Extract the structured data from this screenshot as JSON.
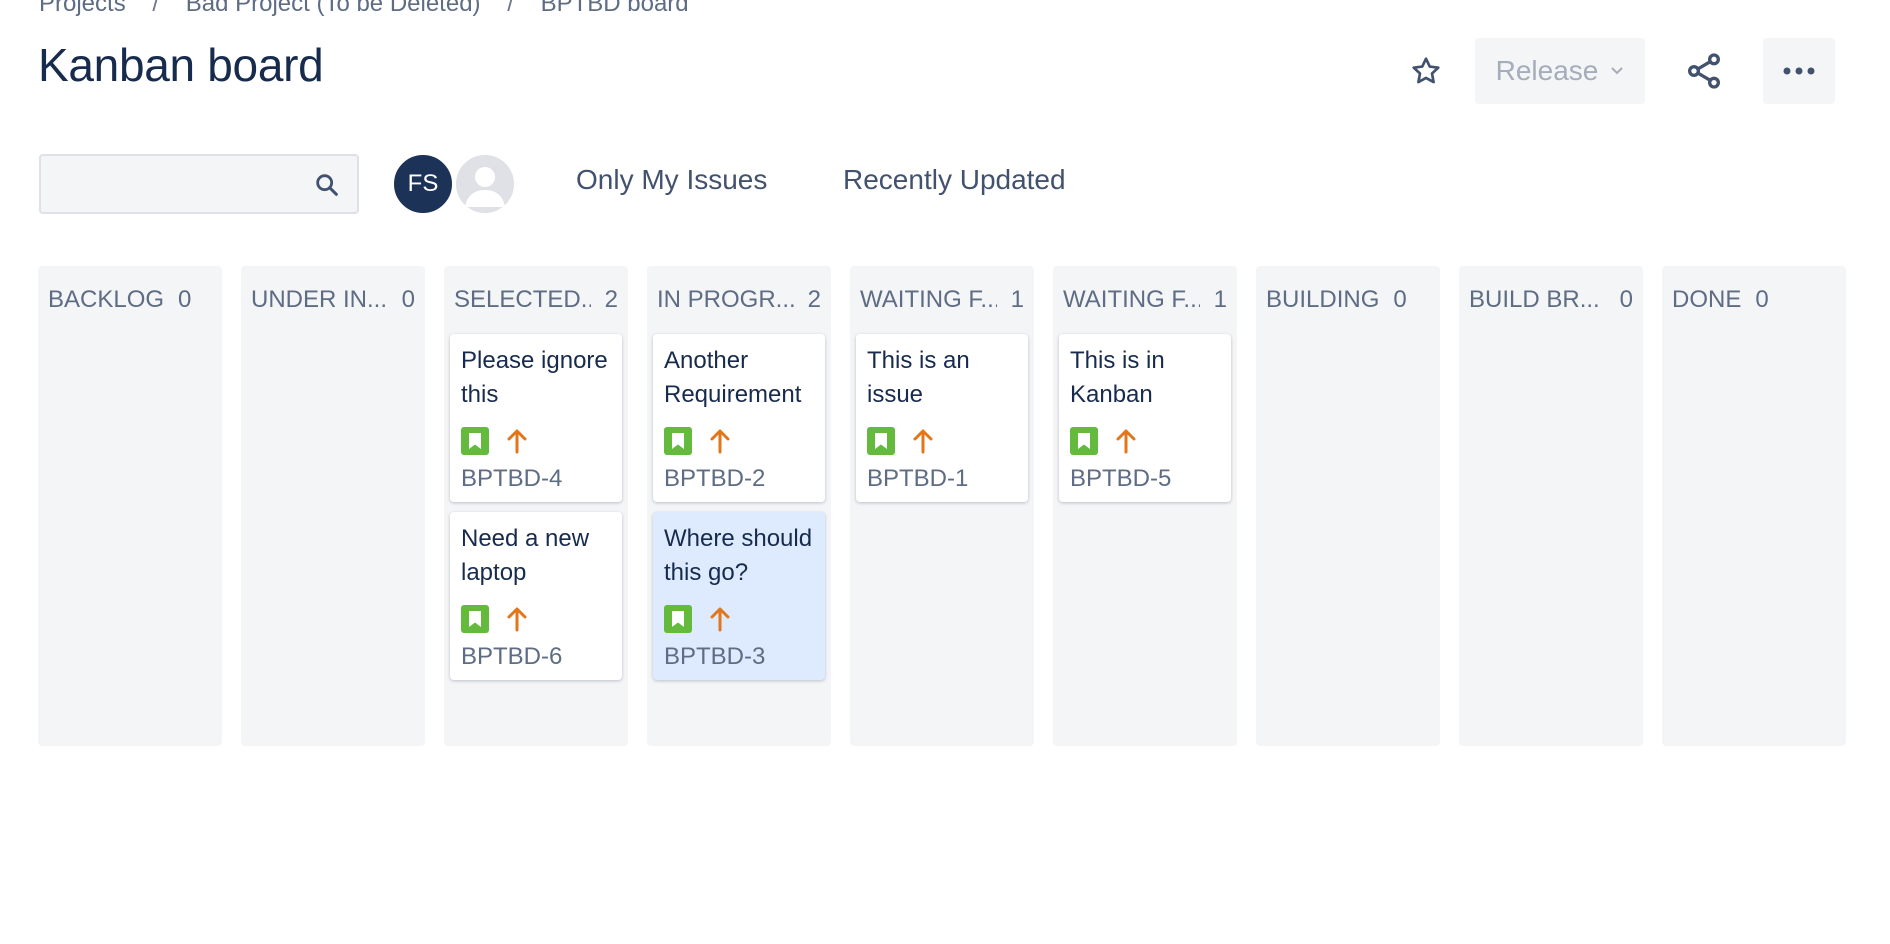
{
  "breadcrumbs": [
    {
      "label": "Projects"
    },
    {
      "label": "Bad Project (To be Deleted)"
    },
    {
      "label": "BPTBD board"
    }
  ],
  "breadcrumb_separator": "/",
  "title": "Kanban board",
  "actions": {
    "release_label": "Release",
    "star_icon": "star-icon",
    "share_icon": "share-icon",
    "more_icon": "more-icon"
  },
  "search": {
    "value": "",
    "placeholder": ""
  },
  "avatars": [
    {
      "initials": "FS",
      "color": "#1c3257"
    },
    {
      "initials": "",
      "color": "#dfe1e6"
    }
  ],
  "quick_filters": {
    "only_mine": "Only My Issues",
    "recently_updated": "Recently Updated"
  },
  "colors": {
    "story": "#63ba3c",
    "priority_high": "#e2761b",
    "selected_card": "#deebff",
    "column_bg": "#f4f5f7"
  },
  "columns": [
    {
      "name": "BACKLOG",
      "count": "0",
      "cards": []
    },
    {
      "name": "UNDER IN...",
      "count": "0",
      "cards": []
    },
    {
      "name": "SELECTED...",
      "count": "2",
      "cards": [
        {
          "summary": "Please ignore this",
          "key": "BPTBD-4",
          "type": "story",
          "priority": "high",
          "selected": false
        },
        {
          "summary": "Need a new laptop",
          "key": "BPTBD-6",
          "type": "story",
          "priority": "high",
          "selected": false
        }
      ]
    },
    {
      "name": "IN PROGR...",
      "count": "2",
      "cards": [
        {
          "summary": "Another Requirement",
          "key": "BPTBD-2",
          "type": "story",
          "priority": "high",
          "selected": false
        },
        {
          "summary": "Where should this go?",
          "key": "BPTBD-3",
          "type": "story",
          "priority": "high",
          "selected": true
        }
      ]
    },
    {
      "name": "WAITING F...",
      "count": "1",
      "cards": [
        {
          "summary": "This is an issue",
          "key": "BPTBD-1",
          "type": "story",
          "priority": "high",
          "selected": false
        }
      ]
    },
    {
      "name": "WAITING F...",
      "count": "1",
      "cards": [
        {
          "summary": "This is in Kanban",
          "key": "BPTBD-5",
          "type": "story",
          "priority": "high",
          "selected": false
        }
      ]
    },
    {
      "name": "BUILDING",
      "count": "0",
      "cards": []
    },
    {
      "name": "BUILD BR...",
      "count": "0",
      "cards": []
    },
    {
      "name": "DONE",
      "count": "0",
      "cards": []
    }
  ]
}
